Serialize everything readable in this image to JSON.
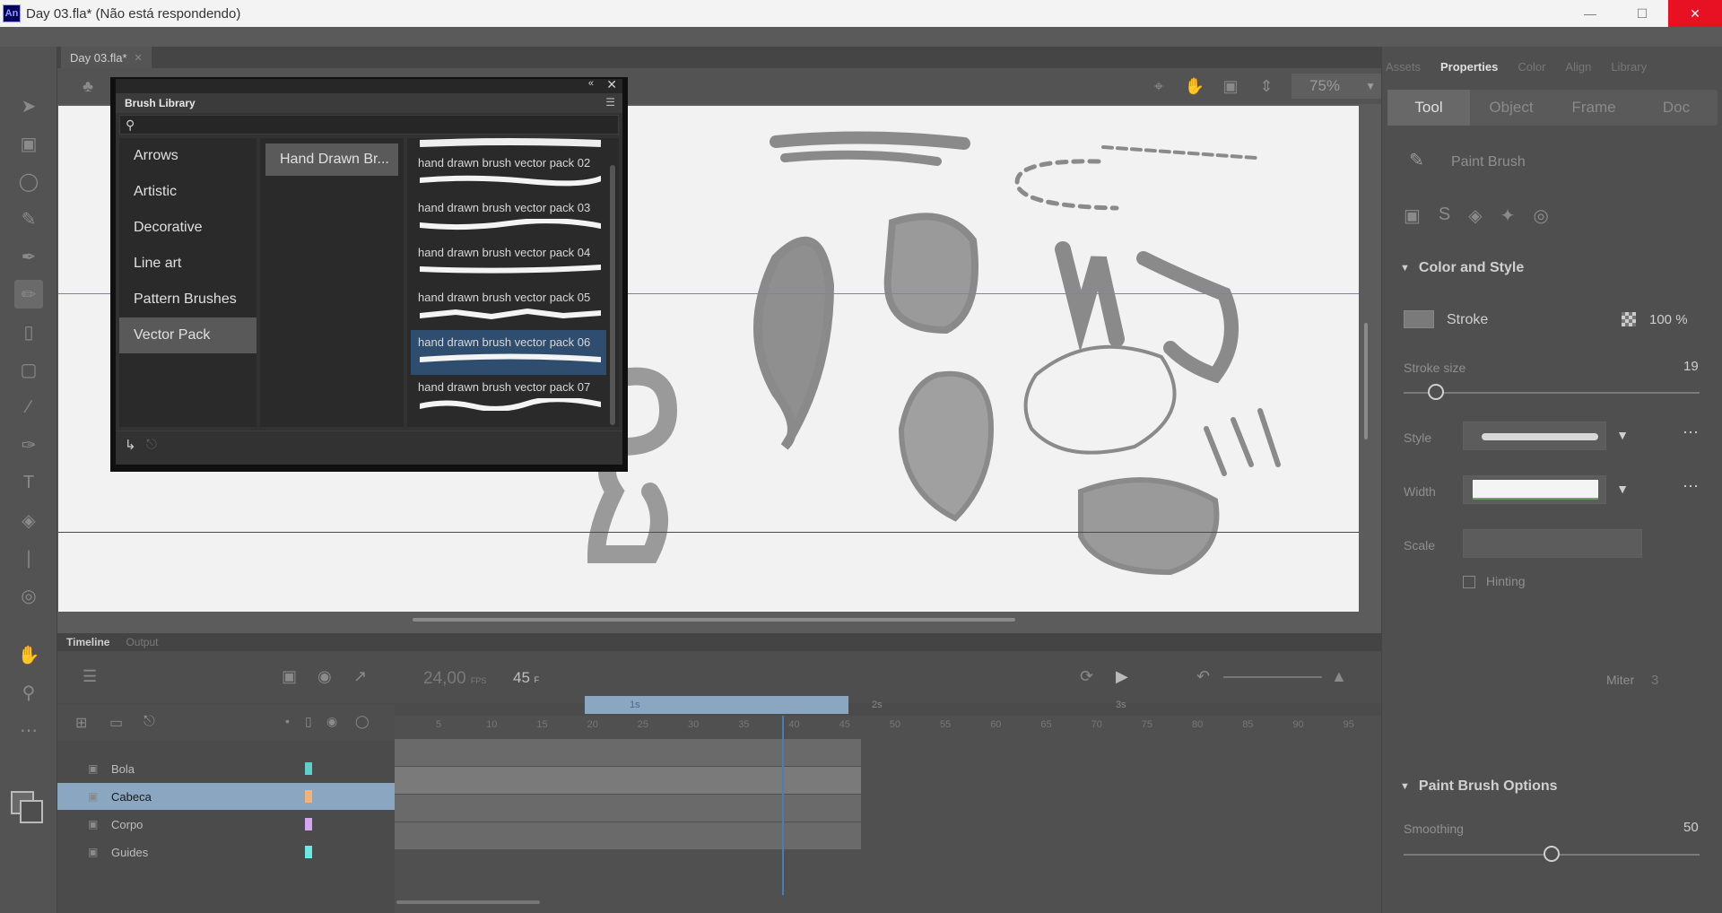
{
  "window": {
    "title": "Day 03.fla* (Não está respondendo)",
    "app_badge": "An",
    "controls": [
      "minimize",
      "maximize",
      "close"
    ]
  },
  "document": {
    "tab_label": "Day 03.fla*",
    "zoom": "75%"
  },
  "toolbar": {
    "icons": [
      "selection-icon",
      "free-transform-icon",
      "lasso-icon",
      "paint-brush-icon",
      "brush-icon",
      "fluid-brush-icon",
      "eraser-icon",
      "rectangle-icon",
      "line-icon",
      "pen-icon",
      "text-icon",
      "paint-bucket-icon",
      "eyedropper-icon",
      "pin-icon",
      "hand-icon",
      "zoom-icon",
      "more-icon"
    ]
  },
  "timeline": {
    "tabs": [
      "Timeline",
      "Output"
    ],
    "fps": "24,00",
    "fps_unit": "FPS",
    "current_frame": "45",
    "frame_unit": "F",
    "seconds_markers": [
      "1s",
      "2s",
      "3s"
    ],
    "ruler": [
      "5",
      "10",
      "15",
      "20",
      "25",
      "30",
      "35",
      "40",
      "45",
      "50",
      "55",
      "60",
      "65",
      "70",
      "75",
      "80",
      "85",
      "90",
      "95"
    ],
    "layers": [
      {
        "name": "Bola",
        "color": "#5ad1c9",
        "selected": false
      },
      {
        "name": "Cabeca",
        "color": "#f4b27a",
        "selected": true
      },
      {
        "name": "Corpo",
        "color": "#d5a6f0",
        "selected": false
      },
      {
        "name": "Guides",
        "color": "#6ee6e6",
        "selected": false
      }
    ]
  },
  "properties": {
    "tabs": [
      "Assets",
      "Properties",
      "Color",
      "Align",
      "Library"
    ],
    "active_tab": "Properties",
    "subtabs": [
      "Tool",
      "Object",
      "Frame",
      "Doc"
    ],
    "active_subtab": "Tool",
    "tool_name": "Paint Brush",
    "color_section": "Color and Style",
    "stroke_label": "Stroke",
    "stroke_alpha": "100 %",
    "stroke_size_label": "Stroke size",
    "stroke_size_value": "19",
    "style_label": "Style",
    "width_label": "Width",
    "scale_label": "Scale",
    "hinting_label": "Hinting",
    "miter_label": "Miter",
    "miter_value": "3",
    "brush_options_section": "Paint Brush Options",
    "smoothing_label": "Smoothing",
    "smoothing_value": "50",
    "smoothing_fraction": 0.5,
    "stroke_size_fraction": 0.11
  },
  "brush_library": {
    "title": "Brush Library",
    "search_placeholder": "",
    "categories": [
      "Arrows",
      "Artistic",
      "Decorative",
      "Line art",
      "Pattern Brushes",
      "Vector Pack"
    ],
    "selected_category": "Vector Pack",
    "subcategory": "Hand Drawn Br...",
    "brushes": [
      {
        "label": "hand drawn brush vector pack 02",
        "selected": false
      },
      {
        "label": "hand drawn brush vector pack 03",
        "selected": false
      },
      {
        "label": "hand drawn brush vector pack 04",
        "selected": false
      },
      {
        "label": "hand drawn brush vector pack 05",
        "selected": false
      },
      {
        "label": "hand drawn brush vector pack 06",
        "selected": true
      },
      {
        "label": "hand drawn brush vector pack 07",
        "selected": false
      }
    ]
  }
}
